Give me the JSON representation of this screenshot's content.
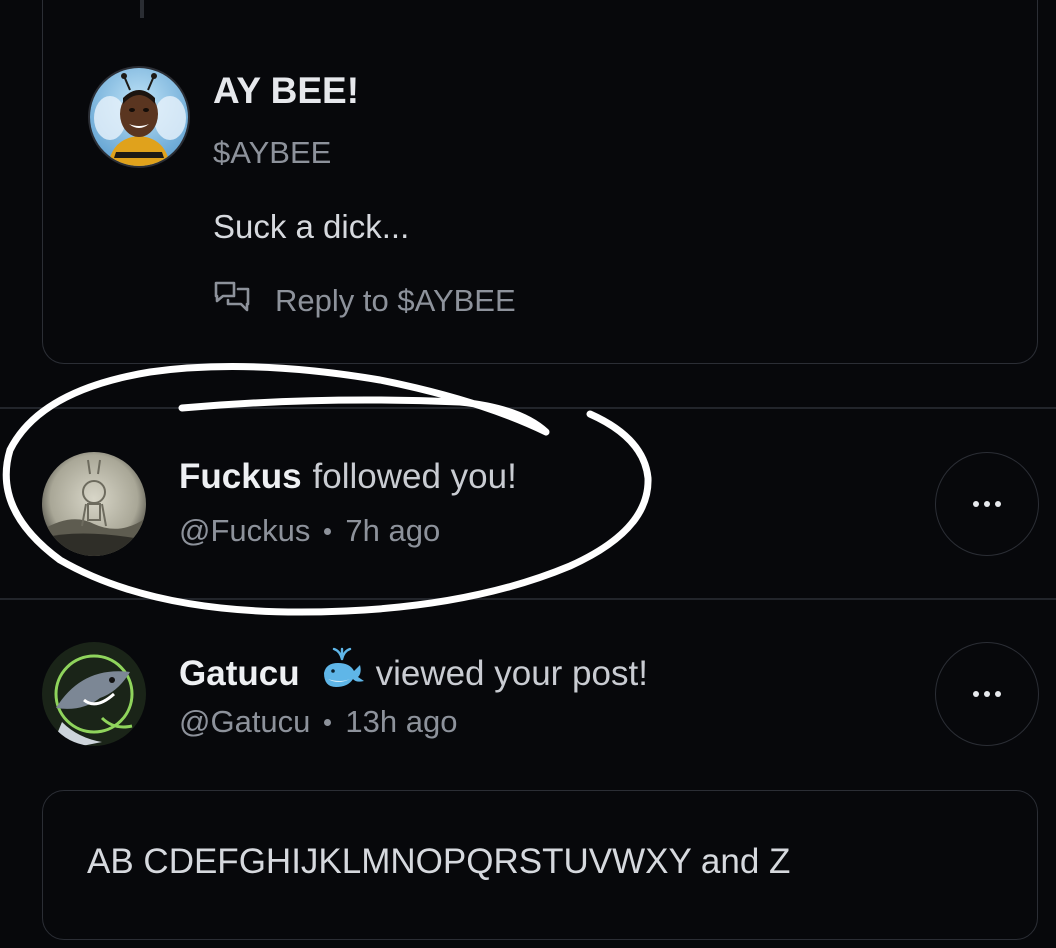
{
  "post": {
    "author_name": "AY BEE!",
    "author_handle": "$AYBEE",
    "text": "Suck a dick...",
    "reply_label": "Reply to $AYBEE"
  },
  "notifications": [
    {
      "name": "Fuckus",
      "action": "followed you!",
      "handle": "@Fuckus",
      "time": "7h ago",
      "more_label": "•••"
    },
    {
      "name": "Gatucu",
      "action": "viewed your post!",
      "handle": "@Gatucu",
      "time": "13h ago",
      "badge_icon": "whale-icon",
      "more_label": "•••"
    }
  ],
  "quoted_post": {
    "text": "AB CDEFGHIJKLMNOPQRSTUVWXY and Z"
  },
  "colors": {
    "background": "#07080b",
    "border": "#2b2e35",
    "muted_text": "#8d929b",
    "annotation": "#ffffff"
  }
}
